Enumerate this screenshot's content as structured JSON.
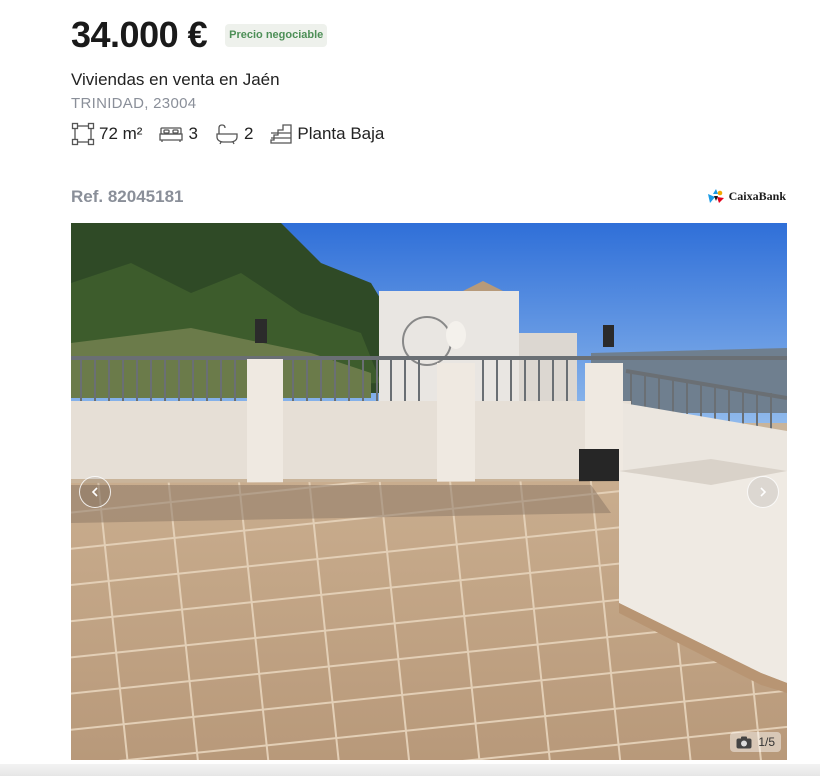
{
  "listing": {
    "price": "34.000 €",
    "badge": "Precio negociable",
    "title": "Viviendas en venta en Jaén",
    "location": "TRINIDAD, 23004",
    "features": {
      "area": "72 m²",
      "bedrooms": "3",
      "bathrooms": "2",
      "floor": "Planta Baja"
    },
    "reference": "Ref. 82045181",
    "bank": "CaixaBank"
  },
  "gallery": {
    "counter": "1/5",
    "prev_icon": "chevron-left-icon",
    "next_icon": "chevron-right-icon",
    "camera_icon": "camera-icon"
  },
  "colors": {
    "badge_text": "#4d8f57",
    "badge_bg": "#eef1ec",
    "muted_text": "#8a8f99"
  }
}
